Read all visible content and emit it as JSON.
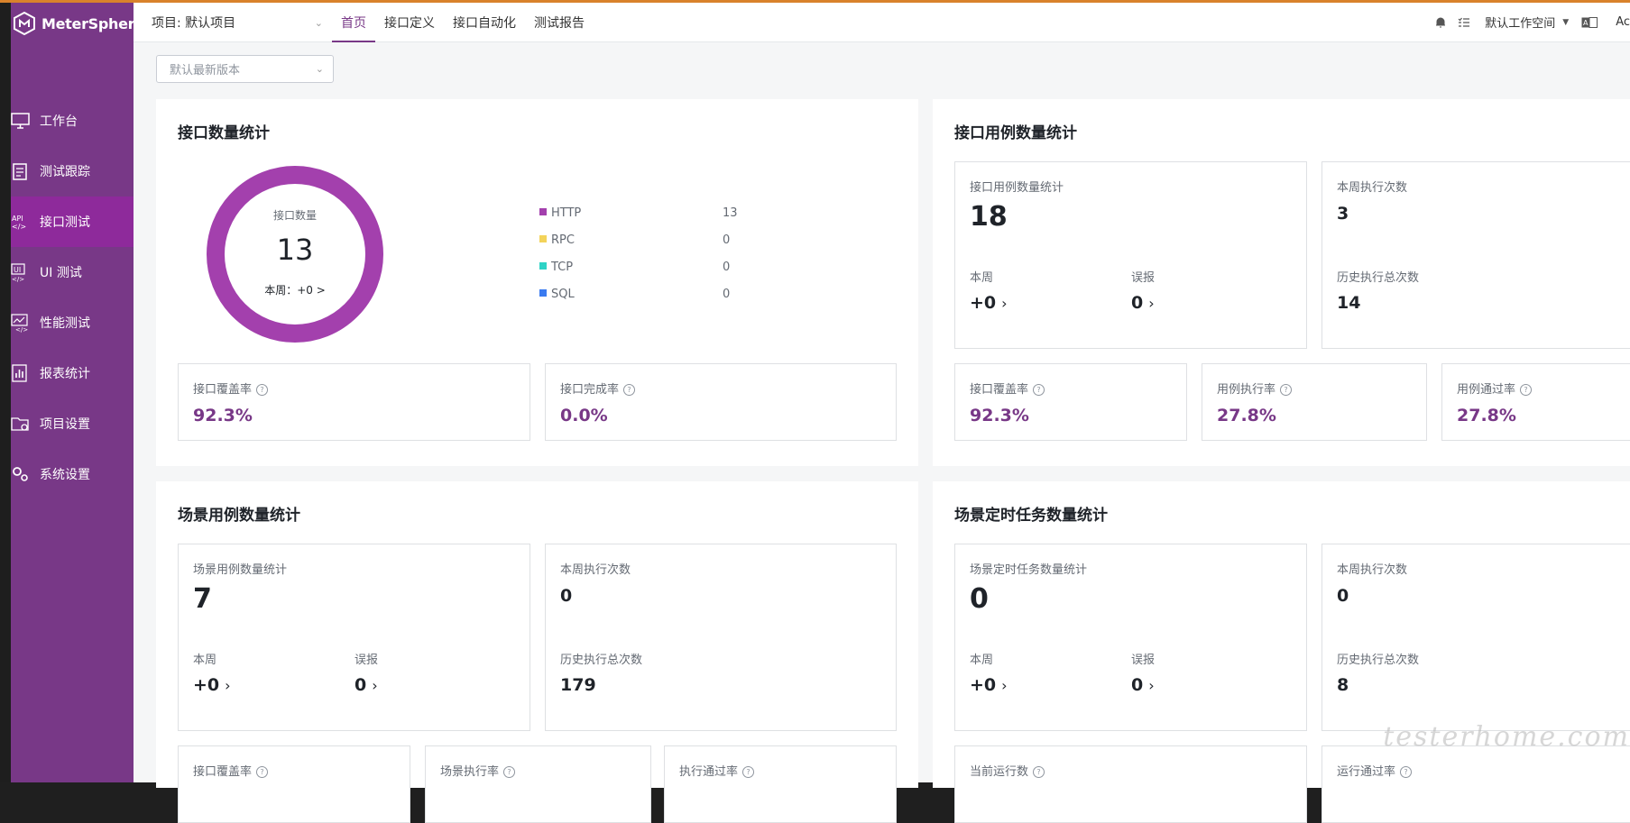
{
  "app": {
    "name": "MeterSphere"
  },
  "sidebar": {
    "items": [
      {
        "label": "工作台",
        "icon": "monitor-icon"
      },
      {
        "label": "测试跟踪",
        "icon": "clipboard-icon"
      },
      {
        "label": "接口测试",
        "icon": "api-icon",
        "active": true
      },
      {
        "label": "UI 测试",
        "icon": "ui-icon"
      },
      {
        "label": "性能测试",
        "icon": "performance-icon"
      },
      {
        "label": "报表统计",
        "icon": "report-icon"
      },
      {
        "label": "项目设置",
        "icon": "folder-settings-icon"
      },
      {
        "label": "系统设置",
        "icon": "gears-icon"
      }
    ]
  },
  "header": {
    "project": "项目: 默认项目",
    "tabs": [
      {
        "label": "首页",
        "active": true
      },
      {
        "label": "接口定义"
      },
      {
        "label": "接口自动化"
      },
      {
        "label": "测试报告"
      }
    ],
    "workspace": "默认工作空间",
    "user": "Ac"
  },
  "version_select": {
    "value": "默认最新版本"
  },
  "api_count": {
    "title": "接口数量统计",
    "donut_label": "接口数量",
    "donut_total": "13",
    "donut_week": "本周：+0 >",
    "legend": [
      {
        "name": "HTTP",
        "value": "13",
        "color": "#a340ad"
      },
      {
        "name": "RPC",
        "value": "0",
        "color": "#f3d35a"
      },
      {
        "name": "TCP",
        "value": "0",
        "color": "#2ed3c6"
      },
      {
        "name": "SQL",
        "value": "0",
        "color": "#3a7bf0"
      }
    ],
    "coverage_label": "接口覆盖率",
    "coverage_value": "92.3%",
    "completion_label": "接口完成率",
    "completion_value": "0.0%"
  },
  "api_case": {
    "title": "接口用例数量统计",
    "box_label": "接口用例数量统计",
    "box_value": "18",
    "week_label": "本周",
    "week_value": "+0",
    "false_label": "误报",
    "false_value": "0",
    "exec_week_label": "本周执行次数",
    "exec_week_value": "3",
    "exec_total_label": "历史执行总次数",
    "exec_total_value": "14",
    "coverage_label": "接口覆盖率",
    "coverage_value": "92.3%",
    "exec_rate_label": "用例执行率",
    "exec_rate_value": "27.8%",
    "pass_rate_label": "用例通过率",
    "pass_rate_value": "27.8%"
  },
  "scenario_case": {
    "title": "场景用例数量统计",
    "box_label": "场景用例数量统计",
    "box_value": "7",
    "week_label": "本周",
    "week_value": "+0",
    "false_label": "误报",
    "false_value": "0",
    "exec_week_label": "本周执行次数",
    "exec_week_value": "0",
    "exec_total_label": "历史执行总次数",
    "exec_total_value": "179",
    "coverage_label": "接口覆盖率",
    "exec_rate_label": "场景执行率",
    "pass_rate_label": "执行通过率"
  },
  "scenario_schedule": {
    "title": "场景定时任务数量统计",
    "box_label": "场景定时任务数量统计",
    "box_value": "0",
    "week_label": "本周",
    "week_value": "+0",
    "false_label": "误报",
    "false_value": "0",
    "exec_week_label": "本周执行次数",
    "exec_week_value": "0",
    "exec_total_label": "历史执行总次数",
    "exec_total_value": "8",
    "running_label": "当前运行数",
    "run_pass_label": "运行通过率"
  },
  "watermark": "testerhome.com"
}
